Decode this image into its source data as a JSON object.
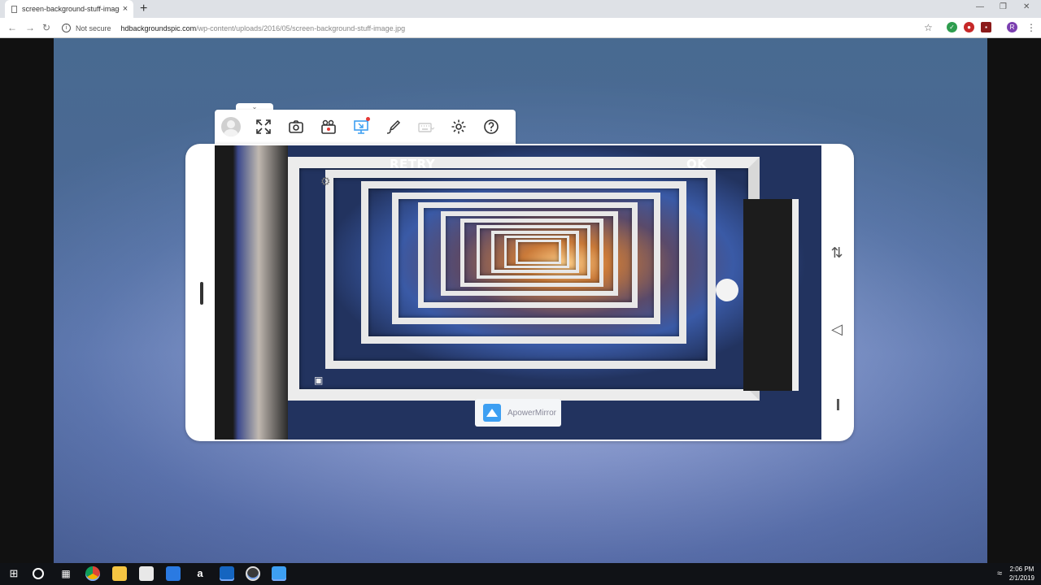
{
  "browser": {
    "tab_title": "screen-background-stuff-image.j",
    "tab_close": "×",
    "new_tab": "+",
    "security_label": "Not secure",
    "url_host": "hdbackgroundspic.com",
    "url_path": "/wp-content/uploads/2016/05/screen-background-stuff-image.jpg",
    "profile_initial": "R"
  },
  "mirror_toolbar": {
    "buttons": [
      "avatar",
      "fullscreen-icon",
      "screenshot-icon",
      "record-icon",
      "screen-cast-icon",
      "draw-icon",
      "keyboard-icon",
      "settings-icon",
      "help-icon"
    ],
    "collapse_glyph": "⌄"
  },
  "phone_screen": {
    "retry_label": "RETRY",
    "ok_label": "OK",
    "app_badge": "ApowerMirror"
  },
  "colors": {
    "accent": "#3d9ff2",
    "notification_dot": "#e53935"
  },
  "taskbar": {
    "time": "2:06 PM",
    "date": "2/1/2019",
    "apps": [
      "chrome",
      "file-explorer",
      "store",
      "dropbox",
      "amazon",
      "outlook",
      "obs",
      "apowermirror"
    ]
  }
}
